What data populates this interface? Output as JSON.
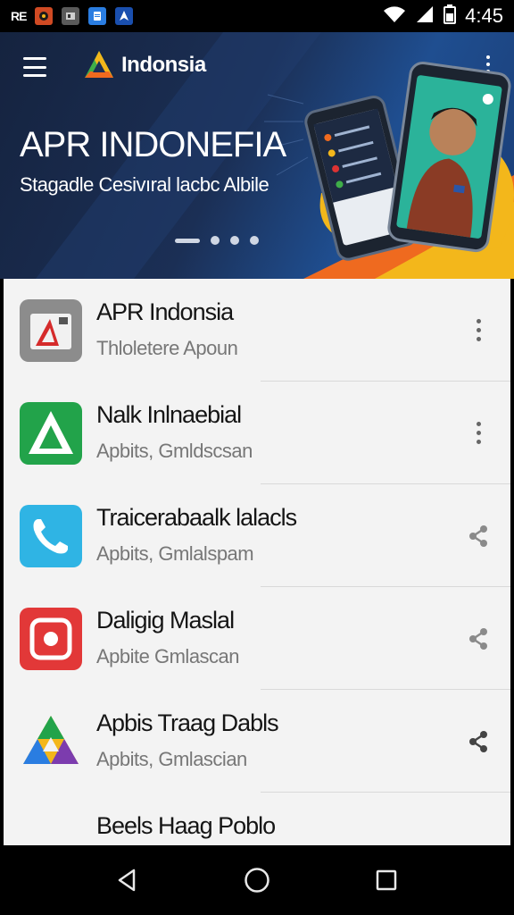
{
  "status_bar": {
    "carrier_text": "RE",
    "time": "4:45",
    "notification_icons": [
      "game-icon",
      "photo-icon",
      "docs-icon",
      "maps-icon"
    ]
  },
  "banner": {
    "brand_name": "Indonsia",
    "title": "APR INDONEFIA",
    "subtitle": "Stagadle Cesivıral lacbc Albile",
    "pager_count": 4,
    "pager_active_index": 0
  },
  "apps": [
    {
      "title": "APR Indonsia",
      "subtitle": "Thloletere Apoun",
      "icon": "apr-app-icon",
      "action": "more-vert-icon"
    },
    {
      "title": "Nalk Inlnaebial",
      "subtitle": "Apbits, Gmldscsan",
      "icon": "triangle-app-icon",
      "action": "more-vert-icon"
    },
    {
      "title": "Traicerabaalk lalacls",
      "subtitle": "Apbits, Gmlalspam",
      "icon": "phone-app-icon",
      "action": "share-icon"
    },
    {
      "title": "Daligig Maslal",
      "subtitle": "Apbite Gmlascan",
      "icon": "camera-app-icon",
      "action": "share-icon"
    },
    {
      "title": "Apbis Traag Dabls",
      "subtitle": "Apbits, Gmlascian",
      "icon": "drive-app-icon",
      "action": "share-icon"
    },
    {
      "title": "Beels Haag Poblo",
      "subtitle": "",
      "icon": "play-app-icon",
      "action": "share-icon"
    }
  ],
  "colors": {
    "banner_dark": "#15233f",
    "banner_blue": "#1f4e90",
    "list_background": "#f3f3f3",
    "accent_yellow": "#f3b71b",
    "accent_orange": "#ef6a1f"
  }
}
